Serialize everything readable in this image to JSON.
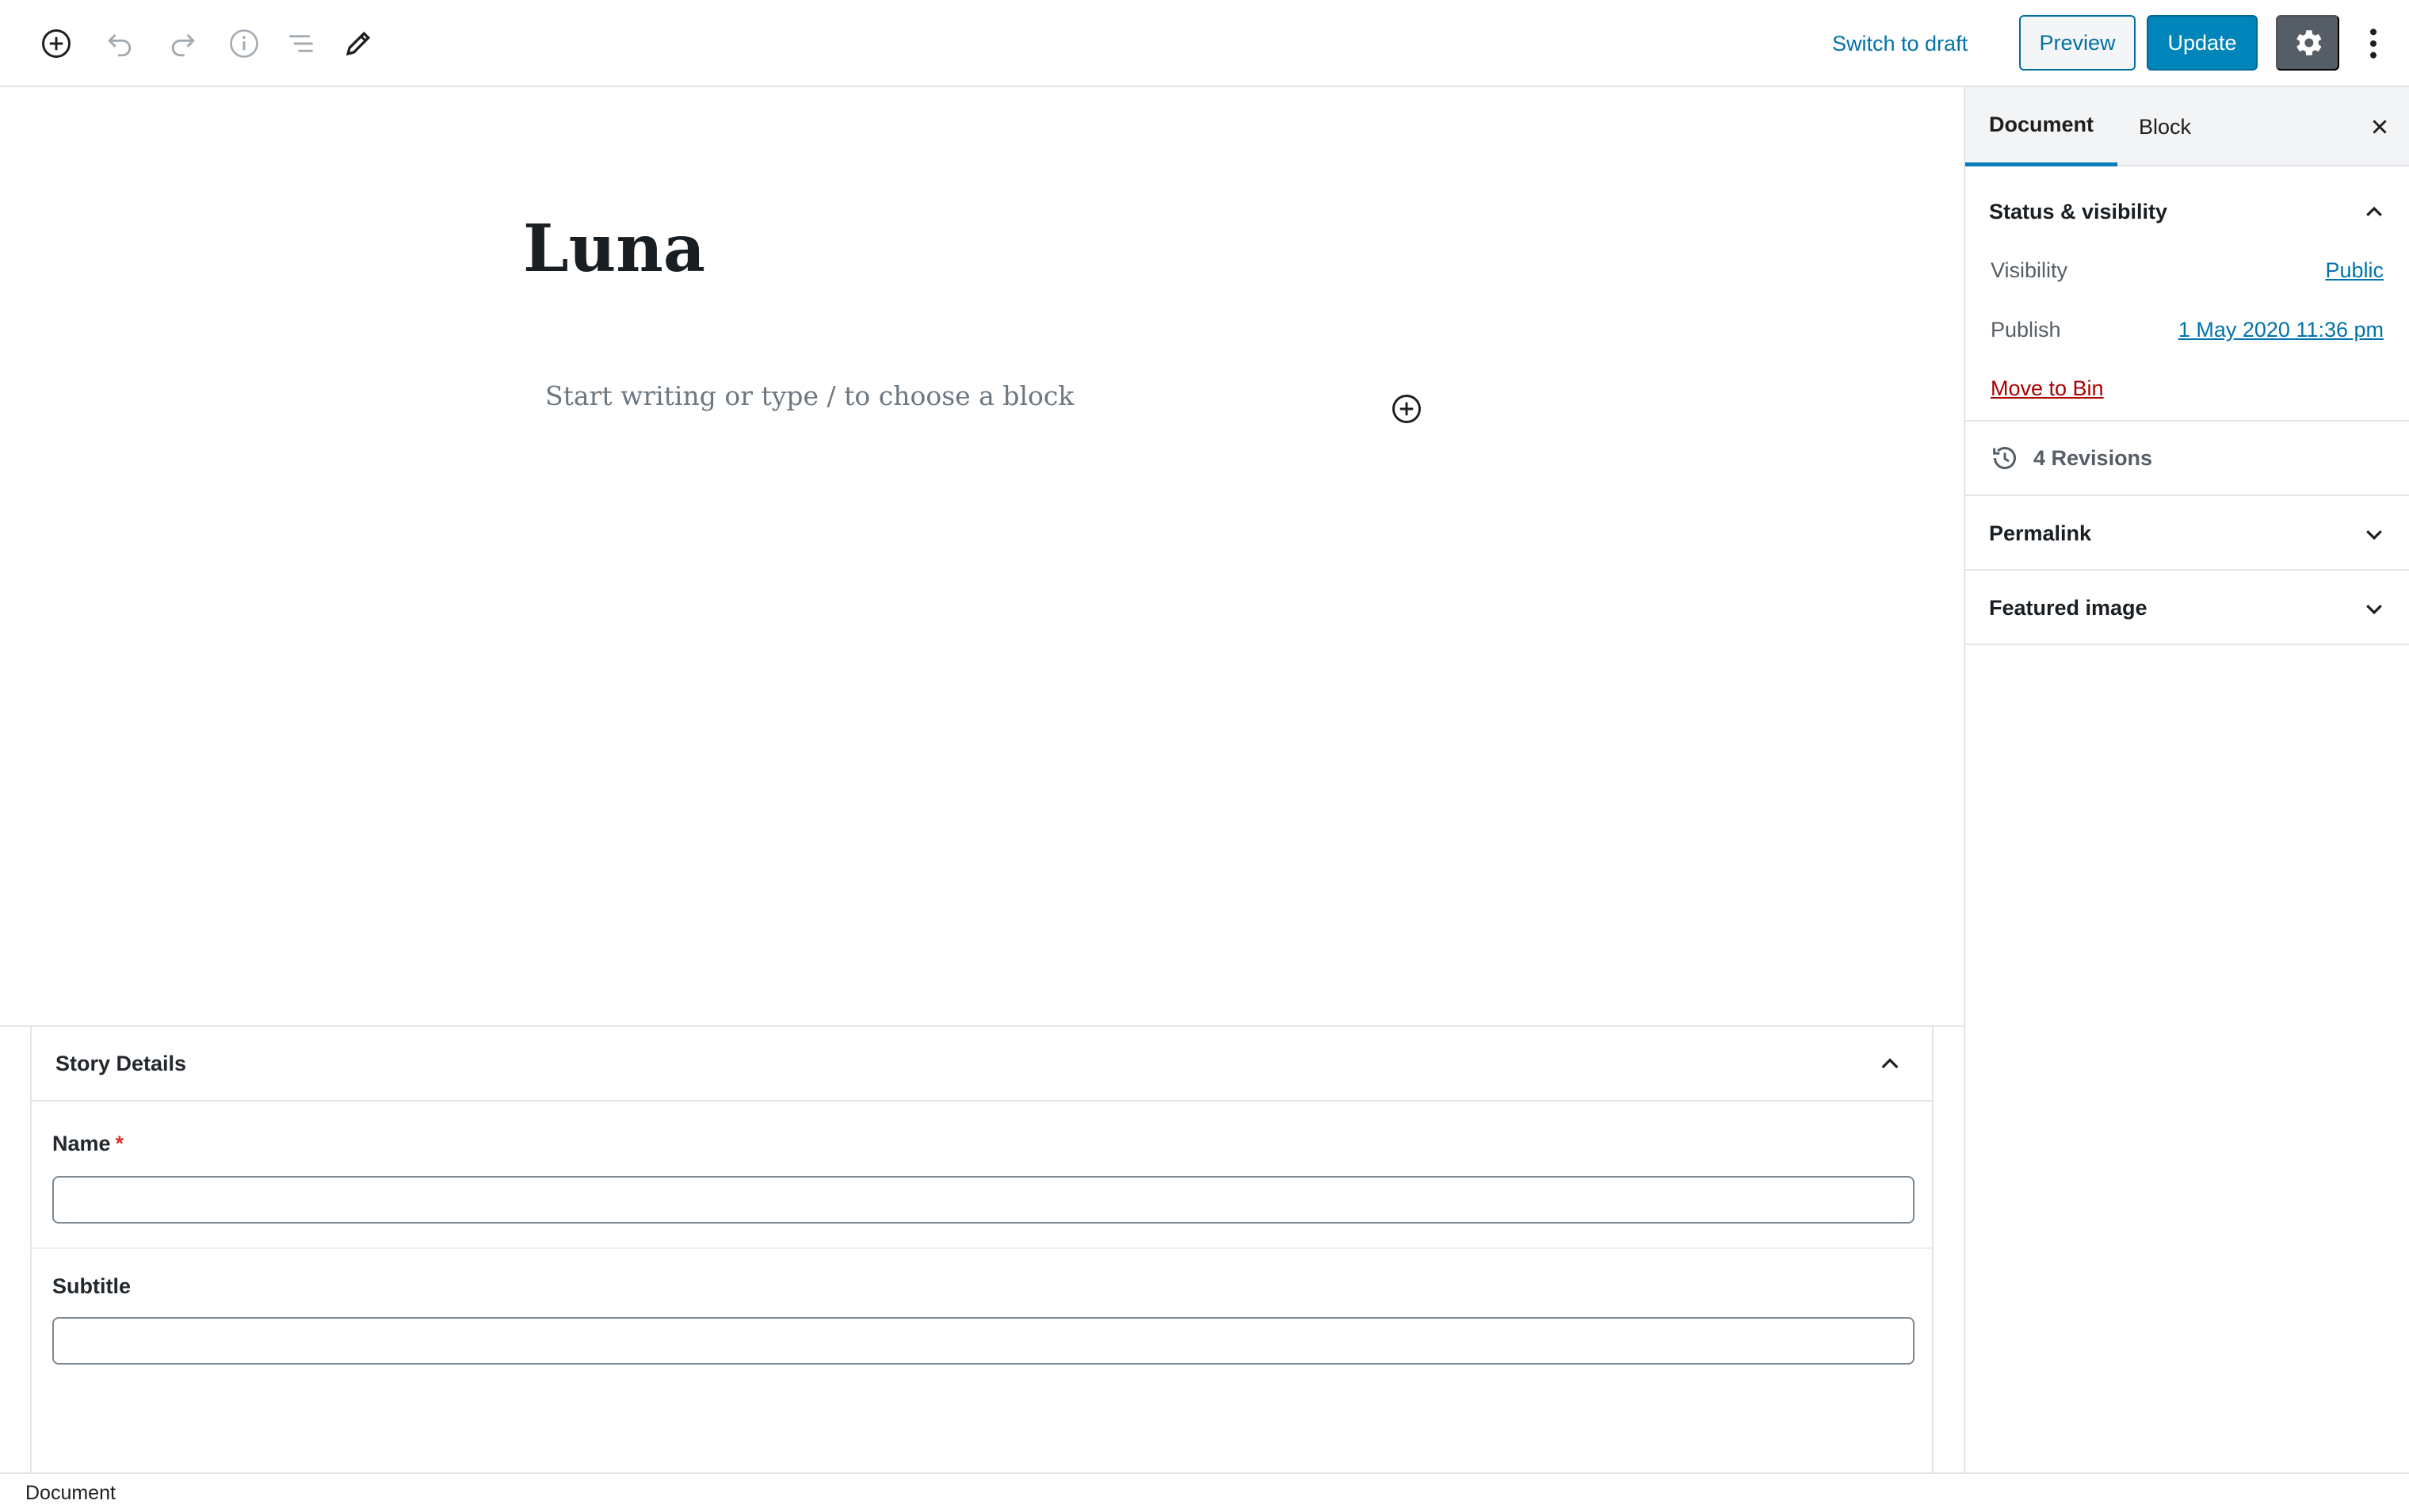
{
  "toolbar": {
    "switch_to_draft": "Switch to draft",
    "preview": "Preview",
    "update": "Update",
    "icons": [
      "add-block-icon",
      "undo-icon",
      "redo-icon",
      "info-icon",
      "list-view-icon",
      "edit-tools-icon",
      "gear-icon",
      "more-vertical-icon"
    ]
  },
  "editor": {
    "title": "Luna",
    "placeholder": "Start writing or type / to choose a block"
  },
  "metabox": {
    "title": "Story Details",
    "fields": [
      {
        "label": "Name",
        "required_mark": "*",
        "value": ""
      },
      {
        "label": "Subtitle",
        "value": ""
      }
    ]
  },
  "sidebar": {
    "tabs": [
      {
        "label": "Document",
        "active": true
      },
      {
        "label": "Block",
        "active": false
      }
    ],
    "status_panel": {
      "title": "Status & visibility",
      "visibility_label": "Visibility",
      "visibility_value": "Public",
      "publish_label": "Publish",
      "publish_value": "1 May 2020 11:36 pm",
      "move_to_bin": "Move to Bin"
    },
    "revisions": "4 Revisions",
    "panels": [
      {
        "title": "Permalink"
      },
      {
        "title": "Featured image"
      }
    ]
  },
  "footer": {
    "breadcrumb": "Document"
  },
  "colors": {
    "accent": "#0085ba",
    "link": "#0073aa",
    "danger": "#a00",
    "settings_bg": "#555d66"
  }
}
